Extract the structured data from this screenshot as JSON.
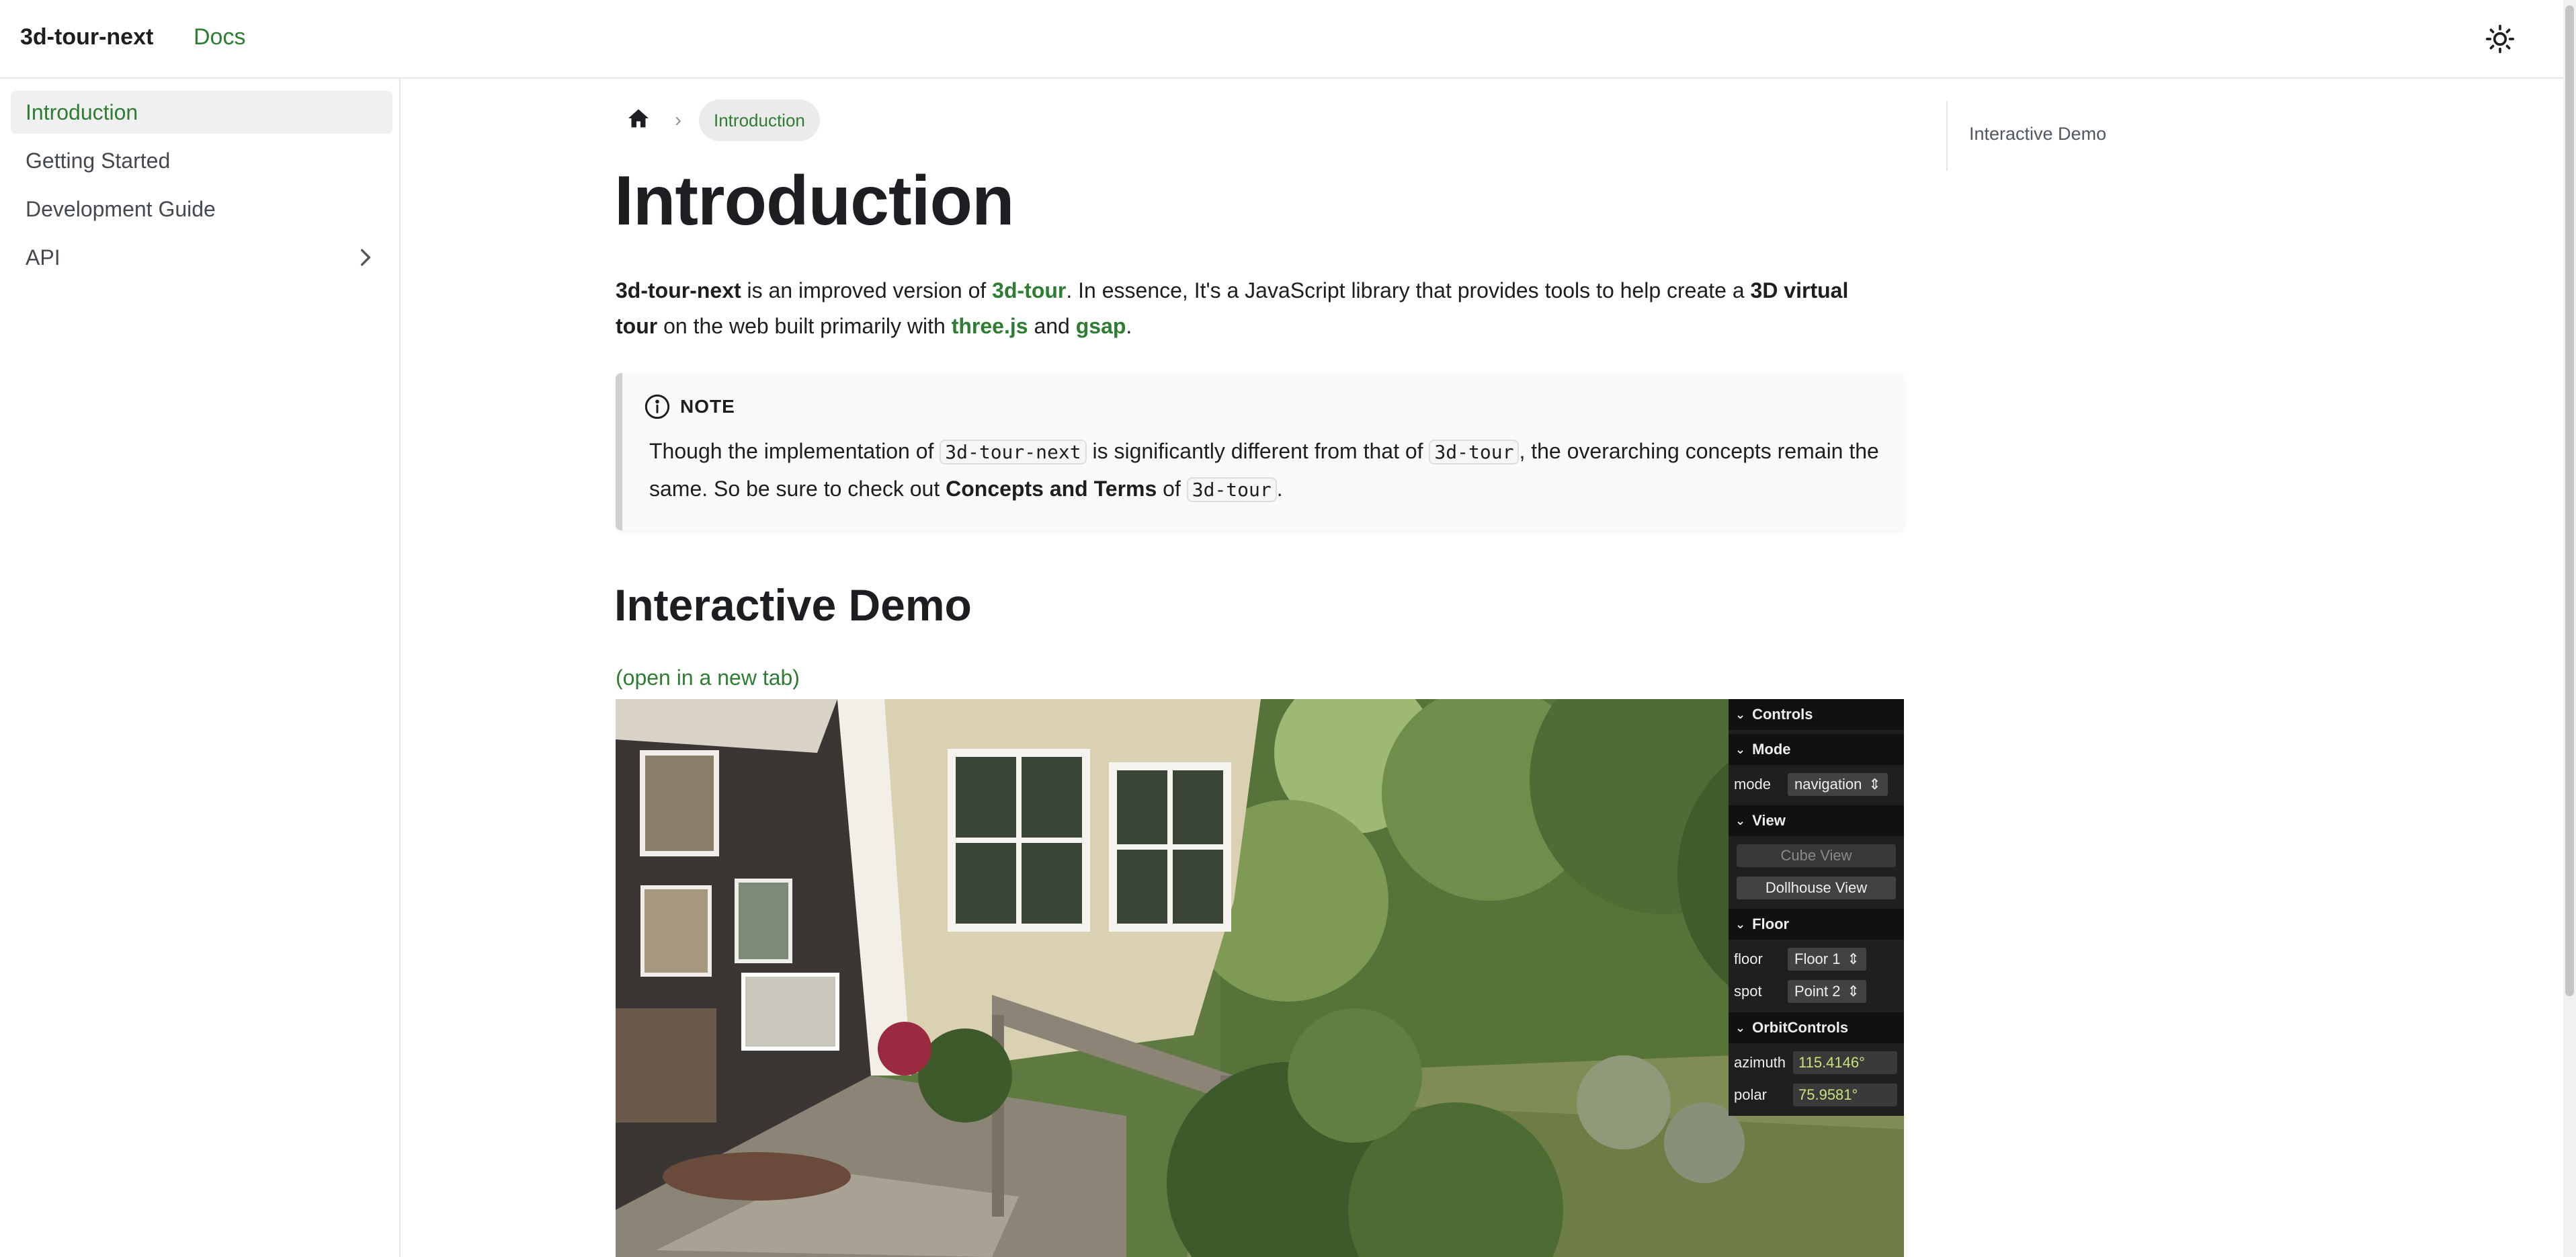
{
  "navbar": {
    "brand": "3d-tour-next",
    "docs_link": "Docs",
    "theme_toggle_icon": "sun-icon"
  },
  "sidebar": {
    "items": [
      {
        "label": "Introduction",
        "active": true
      },
      {
        "label": "Getting Started"
      },
      {
        "label": "Development Guide"
      },
      {
        "label": "API",
        "has_children": true
      }
    ]
  },
  "breadcrumb": {
    "home_icon": "home-icon",
    "separator": "›",
    "current": "Introduction"
  },
  "page": {
    "title": "Introduction",
    "intro": {
      "strong1": "3d-tour-next",
      "t1": " is an improved version of ",
      "link1": "3d-tour",
      "t2": ". In essence, It's a JavaScript library that provides tools to help create a ",
      "strong2": "3D virtual tour",
      "t3": " on the web built primarily with ",
      "link2": "three.js",
      "t4": " and ",
      "link3": "gsap",
      "t5": "."
    },
    "note": {
      "title": "NOTE",
      "icon": "info-icon",
      "t1": "Though the implementation of ",
      "code1": "3d-tour-next",
      "t2": " is significantly different from that of ",
      "code2": "3d-tour",
      "t3": ", the overarching concepts remain the same. So be sure to check out ",
      "strong": "Concepts and Terms",
      "t4": " of ",
      "code3": "3d-tour",
      "t5": "."
    },
    "section_title": "Interactive Demo",
    "open_link": "(open in a new tab)"
  },
  "controls": {
    "title": "Controls",
    "mode_folder": "Mode",
    "mode_label": "mode",
    "mode_value": "navigation",
    "view_folder": "View",
    "cube_view": "Cube View",
    "dollhouse_view": "Dollhouse View",
    "floor_folder": "Floor",
    "floor_label": "floor",
    "floor_value": "Floor 1",
    "spot_label": "spot",
    "spot_value": "Point 2",
    "orbit_folder": "OrbitControls",
    "azimuth_label": "azimuth",
    "azimuth_value": "115.4146°",
    "polar_label": "polar",
    "polar_value": "75.9581°"
  },
  "toc": {
    "items": [
      "Interactive Demo"
    ]
  },
  "colors": {
    "accent": "#2e7d32",
    "text": "#1c1e21",
    "border": "#e6e6e6"
  }
}
